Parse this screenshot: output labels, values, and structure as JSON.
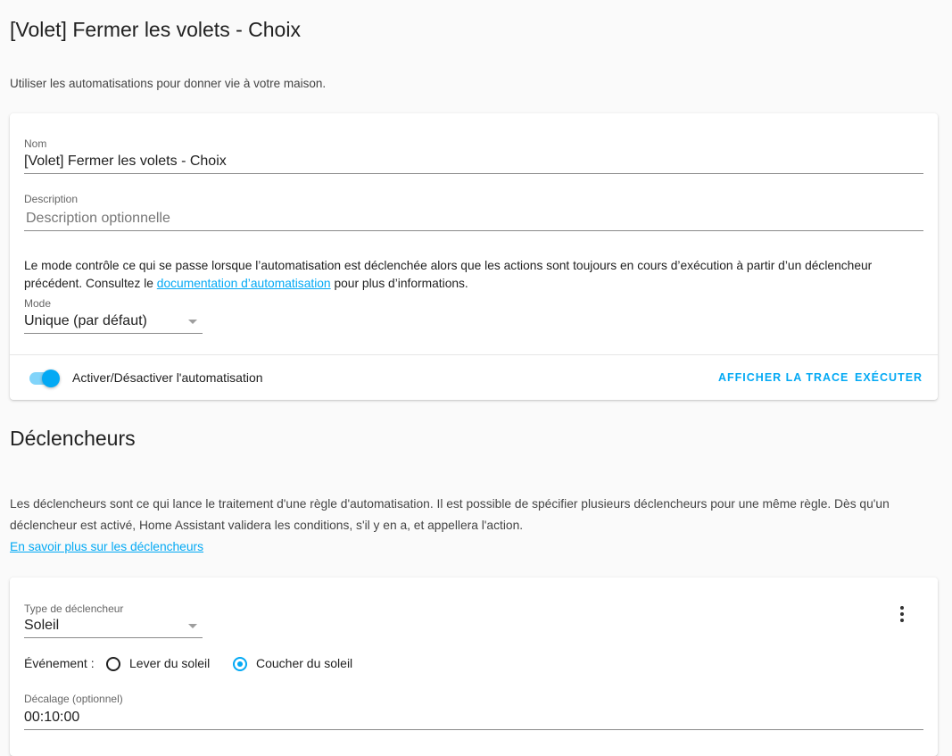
{
  "page": {
    "title": "[Volet] Fermer les volets - Choix",
    "intro": "Utiliser les automatisations pour donner vie à votre maison."
  },
  "details": {
    "name_label": "Nom",
    "name_value": "[Volet] Fermer les volets - Choix",
    "description_label": "Description",
    "description_placeholder": "Description optionnelle",
    "mode_text_before": "Le mode contrôle ce qui se passe lorsque l’automatisation est déclenchée alors que les actions sont toujours en cours d’exécution à partir d’un déclencheur précédent. Consultez le ",
    "mode_link": "documentation d’automatisation",
    "mode_text_after": " pour plus d’informations.",
    "mode_label": "Mode",
    "mode_value": "Unique (par défaut)",
    "toggle_label": "Activer/Désactiver l'automatisation",
    "toggle_on": true,
    "trace_button": "AFFICHER LA TRACE",
    "run_button": "EXÉCUTER"
  },
  "triggers": {
    "title": "Déclencheurs",
    "description": "Les déclencheurs sont ce qui lance le traitement d'une règle d'automatisation. Il est possible de spécifier plusieurs déclencheurs pour une même règle. Dès qu'un déclencheur est activé, Home Assistant validera les conditions, s'il y en a, et appellera l'action.",
    "learn_more": "En savoir plus sur les déclencheurs",
    "type_label": "Type de déclencheur",
    "type_value": "Soleil",
    "event_label": "Événement :",
    "option_sunrise": "Lever du soleil",
    "option_sunset": "Coucher du soleil",
    "selected_event": "sunset",
    "offset_label": "Décalage (optionnel)",
    "offset_value": "00:10:00"
  },
  "colors": {
    "accent": "#03a9f4",
    "background": "#fafafa",
    "card": "#ffffff"
  }
}
